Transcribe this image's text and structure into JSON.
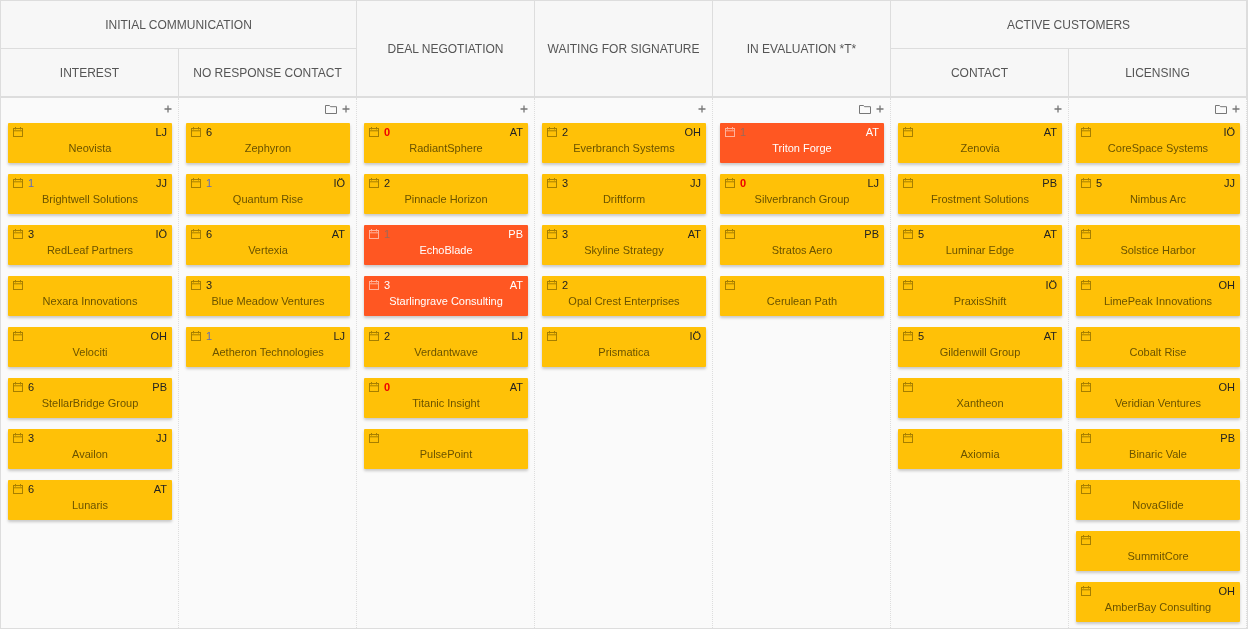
{
  "stages": [
    {
      "title": "INITIAL COMMUNICATION",
      "columns": [
        {
          "title": "INTEREST",
          "cards": [
            {
              "name": "Neovista",
              "owner": "LJ",
              "flagged": false
            },
            {
              "name": "Brightwell Solutions",
              "count": {
                "text": "1",
                "overdue": false,
                "due_soon": true
              },
              "owner": "JJ",
              "flagged": false
            },
            {
              "name": "RedLeaf Partners",
              "count": {
                "text": "3",
                "overdue": false,
                "due_soon": false
              },
              "owner": "IÖ",
              "flagged": false
            },
            {
              "name": "Nexara Innovations",
              "flagged": false
            },
            {
              "name": "Velociti",
              "owner": "OH",
              "flagged": false
            },
            {
              "name": "StellarBridge Group",
              "count": {
                "text": "6",
                "overdue": false,
                "due_soon": false
              },
              "owner": "PB",
              "flagged": false
            },
            {
              "name": "Availon",
              "count": {
                "text": "3",
                "overdue": false,
                "due_soon": false
              },
              "owner": "JJ",
              "flagged": false
            },
            {
              "name": "Lunaris",
              "count": {
                "text": "6",
                "overdue": false,
                "due_soon": false
              },
              "owner": "AT",
              "flagged": false
            }
          ]
        },
        {
          "title": "NO RESPONSE CONTACT",
          "folder": true,
          "cards": [
            {
              "name": "Zephyron",
              "count": {
                "text": "6",
                "overdue": false,
                "due_soon": false
              },
              "flagged": false
            },
            {
              "name": "Quantum Rise",
              "count": {
                "text": "1",
                "overdue": false,
                "due_soon": true
              },
              "owner": "IÖ",
              "flagged": false
            },
            {
              "name": "Vertexia",
              "count": {
                "text": "6",
                "overdue": false,
                "due_soon": false
              },
              "owner": "AT",
              "flagged": false
            },
            {
              "name": "Blue Meadow Ventures",
              "count": {
                "text": "3",
                "overdue": false,
                "due_soon": false
              },
              "flagged": false
            },
            {
              "name": "Aetheron Technologies",
              "count": {
                "text": "1",
                "overdue": false,
                "due_soon": true
              },
              "owner": "LJ",
              "flagged": false
            }
          ]
        }
      ]
    },
    {
      "columns": [
        {
          "title": "DEAL NEGOTIATION",
          "cards": [
            {
              "name": "RadiantSphere",
              "count": {
                "text": "0",
                "overdue": true,
                "due_soon": false
              },
              "owner": "AT",
              "flagged": false
            },
            {
              "name": "Pinnacle Horizon",
              "count": {
                "text": "2",
                "overdue": false,
                "due_soon": false
              },
              "flagged": false
            },
            {
              "name": "EchoBlade",
              "count": {
                "text": "1",
                "overdue": false,
                "due_soon": true
              },
              "owner": "PB",
              "flagged": true
            },
            {
              "name": "Starlingrave Consulting",
              "count": {
                "text": "3",
                "overdue": false,
                "due_soon": false
              },
              "owner": "AT",
              "flagged": true
            },
            {
              "name": "Verdantwave",
              "count": {
                "text": "2",
                "overdue": false,
                "due_soon": false
              },
              "owner": "LJ",
              "flagged": false
            },
            {
              "name": "Titanic Insight",
              "count": {
                "text": "0",
                "overdue": true,
                "due_soon": false
              },
              "owner": "AT",
              "flagged": false
            },
            {
              "name": "PulsePoint",
              "flagged": false
            }
          ]
        }
      ]
    },
    {
      "columns": [
        {
          "title": "WAITING FOR SIGNATURE",
          "cards": [
            {
              "name": "Everbranch Systems",
              "count": {
                "text": "2",
                "overdue": false,
                "due_soon": false
              },
              "owner": "OH",
              "flagged": false
            },
            {
              "name": "Driftform",
              "count": {
                "text": "3",
                "overdue": false,
                "due_soon": false
              },
              "owner": "JJ",
              "flagged": false
            },
            {
              "name": "Skyline Strategy",
              "count": {
                "text": "3",
                "overdue": false,
                "due_soon": false
              },
              "owner": "AT",
              "flagged": false
            },
            {
              "name": "Opal Crest Enterprises",
              "count": {
                "text": "2",
                "overdue": false,
                "due_soon": false
              },
              "flagged": false
            },
            {
              "name": "Prismatica",
              "owner": "IÖ",
              "flagged": false
            }
          ]
        }
      ]
    },
    {
      "columns": [
        {
          "title": "IN EVALUATION *T*",
          "folder": true,
          "cards": [
            {
              "name": "Triton Forge",
              "count": {
                "text": "1",
                "overdue": false,
                "due_soon": true
              },
              "owner": "AT",
              "flagged": true
            },
            {
              "name": "Silverbranch Group",
              "count": {
                "text": "0",
                "overdue": true,
                "due_soon": false
              },
              "owner": "LJ",
              "flagged": false
            },
            {
              "name": "Stratos Aero",
              "owner": "PB",
              "flagged": false
            },
            {
              "name": "Cerulean Path",
              "flagged": false
            }
          ]
        }
      ]
    },
    {
      "title": "ACTIVE CUSTOMERS",
      "columns": [
        {
          "title": "CONTACT",
          "cards": [
            {
              "name": "Zenovia",
              "owner": "AT",
              "flagged": false
            },
            {
              "name": "Frostment Solutions",
              "owner": "PB",
              "flagged": false
            },
            {
              "name": "Luminar Edge",
              "count": {
                "text": "5",
                "overdue": false,
                "due_soon": false
              },
              "owner": "AT",
              "flagged": false
            },
            {
              "name": "PraxisShift",
              "owner": "IÖ",
              "flagged": false
            },
            {
              "name": "Gildenwill Group",
              "count": {
                "text": "5",
                "overdue": false,
                "due_soon": false
              },
              "owner": "AT",
              "flagged": false
            },
            {
              "name": "Xantheon",
              "flagged": false
            },
            {
              "name": "Axiomia",
              "flagged": false
            }
          ]
        },
        {
          "title": "LICENSING",
          "folder": true,
          "cards": [
            {
              "name": "CoreSpace Systems",
              "owner": "IÖ",
              "flagged": false
            },
            {
              "name": "Nimbus Arc",
              "count": {
                "text": "5",
                "overdue": false,
                "due_soon": false
              },
              "owner": "JJ",
              "flagged": false
            },
            {
              "name": "Solstice Harbor",
              "flagged": false
            },
            {
              "name": "LimePeak Innovations",
              "owner": "OH",
              "flagged": false
            },
            {
              "name": "Cobalt Rise",
              "flagged": false
            },
            {
              "name": "Veridian Ventures",
              "owner": "OH",
              "flagged": false
            },
            {
              "name": "Binaric Vale",
              "owner": "PB",
              "flagged": false
            },
            {
              "name": "NovaGlide",
              "flagged": false
            },
            {
              "name": "SummitCore",
              "flagged": false
            },
            {
              "name": "AmberBay Consulting",
              "owner": "OH",
              "flagged": false
            }
          ]
        }
      ]
    }
  ]
}
